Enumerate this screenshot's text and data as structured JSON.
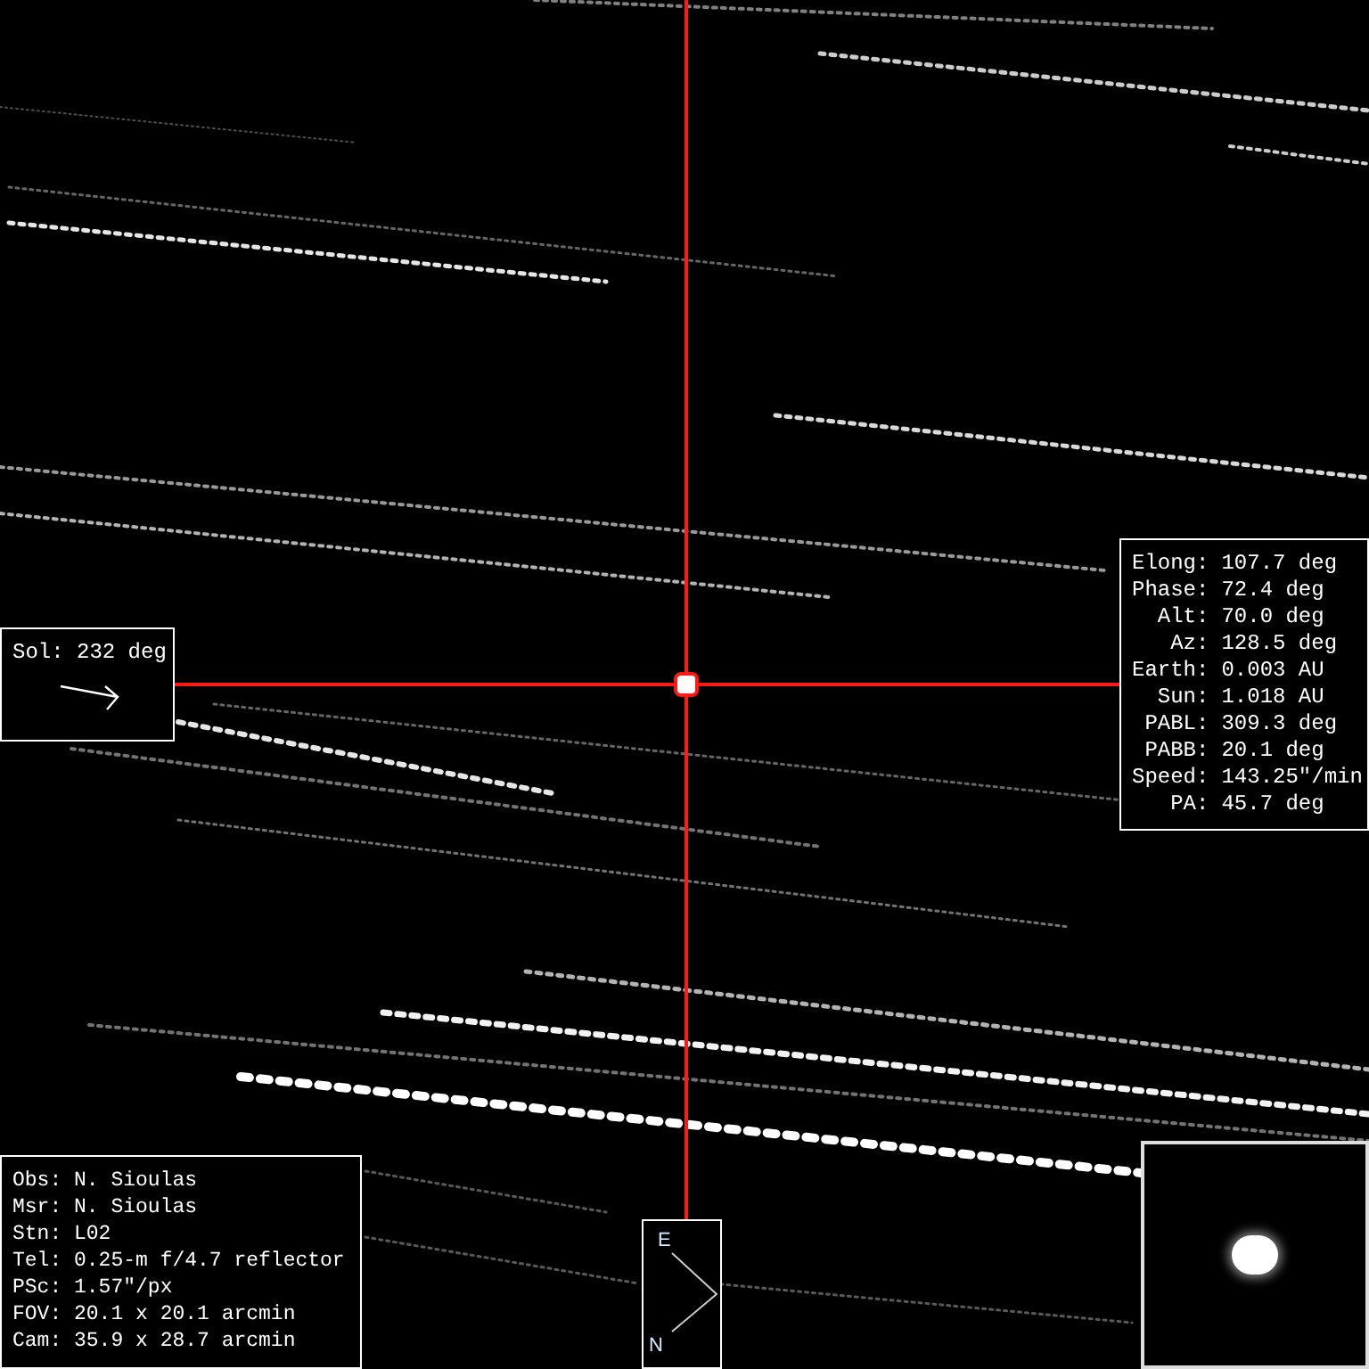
{
  "ephemeris": [
    {
      "label": "Elong:",
      "value": "107.7 deg"
    },
    {
      "label": "Phase:",
      "value": "72.4 deg"
    },
    {
      "label": "Alt:",
      "value": "70.0 deg"
    },
    {
      "label": "Az:",
      "value": "128.5 deg"
    },
    {
      "label": "Earth:",
      "value": "0.003 AU"
    },
    {
      "label": "Sun:",
      "value": "1.018 AU"
    },
    {
      "label": "PABL:",
      "value": "309.3 deg"
    },
    {
      "label": "PABB:",
      "value": "20.1 deg"
    },
    {
      "label": "Speed:",
      "value": "143.25\"/min"
    },
    {
      "label": "PA:",
      "value": "45.7 deg"
    }
  ],
  "sol": {
    "text": "Sol: 232 deg"
  },
  "observer": [
    "Obs: N. Sioulas",
    "Msr: N. Sioulas",
    "Stn: L02",
    "Tel: 0.25-m f/4.7 reflector",
    "PSc: 1.57\"/px",
    "FOV: 20.1 x 20.1 arcmin",
    "Cam: 35.9 x 28.7 arcmin"
  ],
  "compass": {
    "east": "E",
    "north": "N"
  }
}
